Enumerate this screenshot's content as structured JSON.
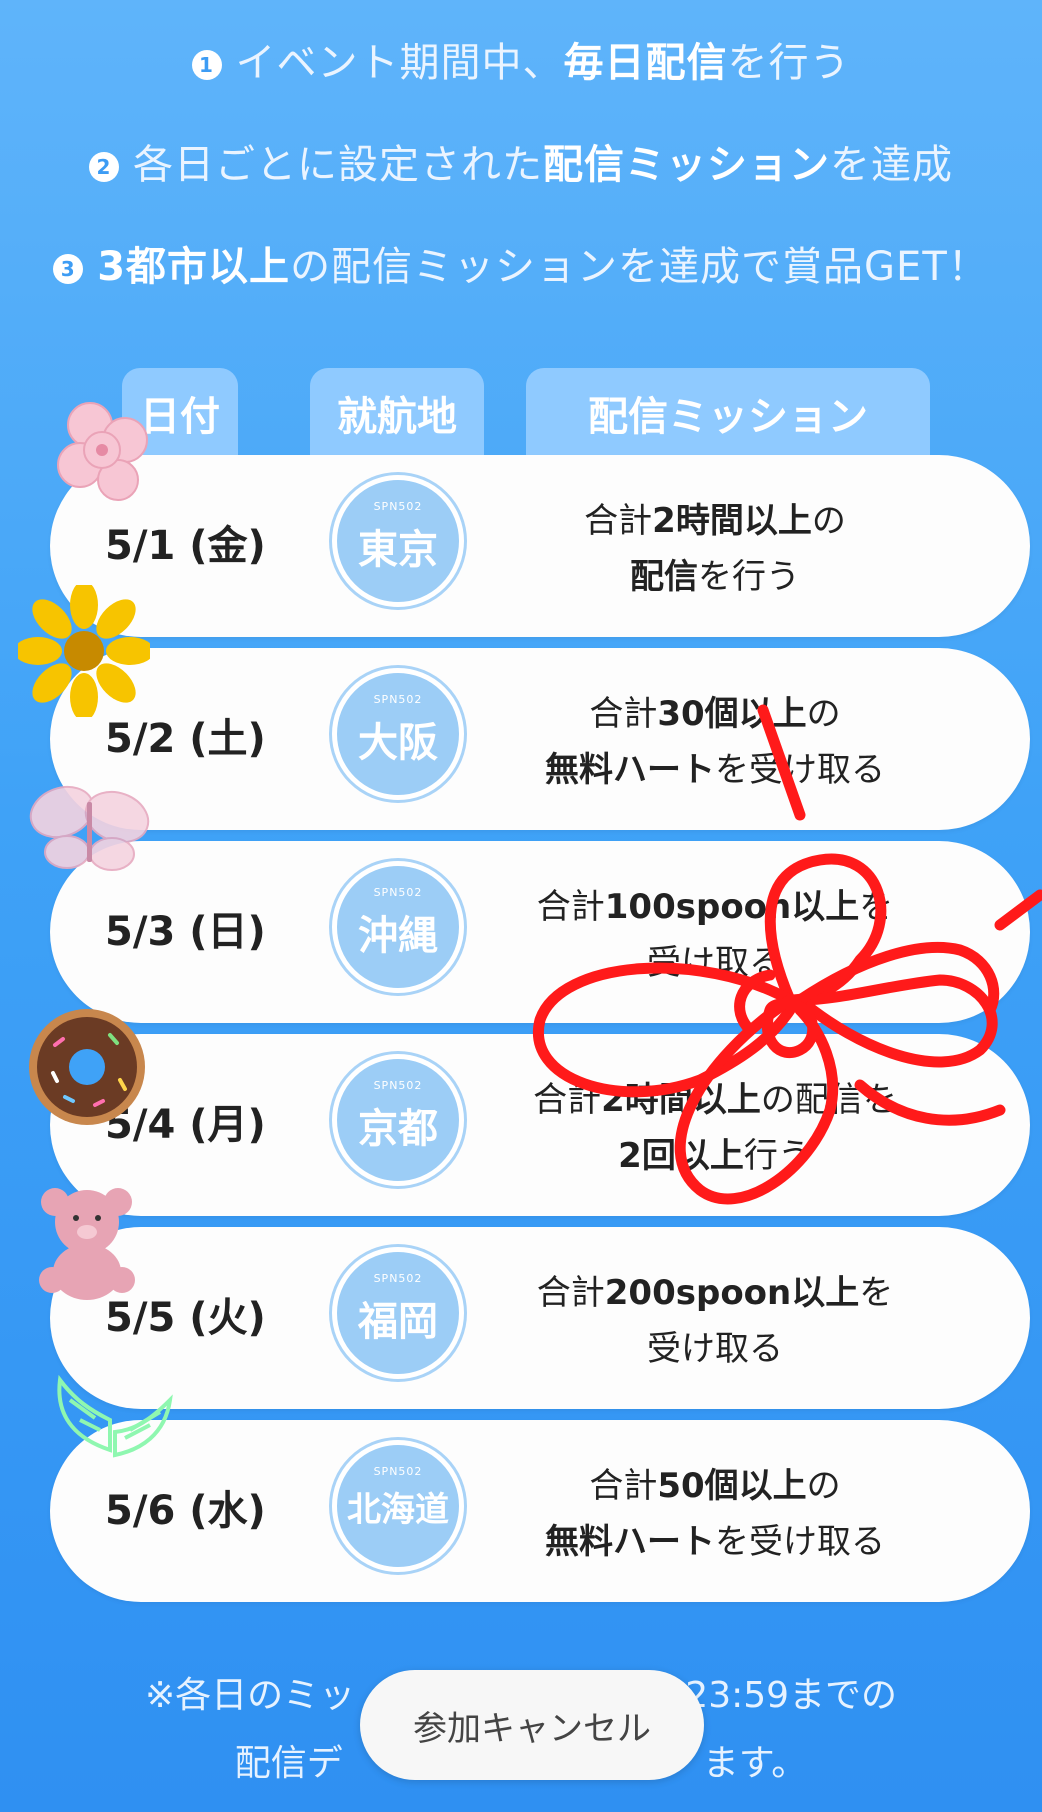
{
  "rules": [
    {
      "num": "1",
      "pre": "イベント期間中、",
      "bold": "毎日配信",
      "post": "を行う"
    },
    {
      "num": "2",
      "pre": "各日ごとに設定された",
      "bold": "配信ミッション",
      "post": "を達成"
    },
    {
      "num": "3",
      "pre": "",
      "bold": "3都市以上",
      "post": "の配信ミッションを達成で賞品GET！"
    }
  ],
  "table_headers": [
    "日付",
    "就航地",
    "配信ミッション"
  ],
  "stamp_code": "SPN502",
  "rows": [
    {
      "date": "5/1 (金)",
      "city": "東京",
      "m1_pre": "合計",
      "m1_bold": "2時間以上",
      "m1_post": "の",
      "m2_pre": "",
      "m2_bold": "配信",
      "m2_post": "を行う"
    },
    {
      "date": "5/2 (土)",
      "city": "大阪",
      "m1_pre": "合計",
      "m1_bold": "30個以上",
      "m1_post": "の",
      "m2_pre": "",
      "m2_bold": "無料ハート",
      "m2_post": "を受け取る"
    },
    {
      "date": "5/3 (日)",
      "city": "沖縄",
      "m1_pre": "合計",
      "m1_bold": "100spoon以上",
      "m1_post": "を",
      "m2_pre": "受け取る",
      "m2_bold": "",
      "m2_post": ""
    },
    {
      "date": "5/4 (月)",
      "city": "京都",
      "m1_pre": "合計",
      "m1_bold": "2時間以上",
      "m1_post": "の配信を",
      "m2_pre": "",
      "m2_bold": "2回以上",
      "m2_post": "行う"
    },
    {
      "date": "5/5 (火)",
      "city": "福岡",
      "m1_pre": "合計",
      "m1_bold": "200spoon以上",
      "m1_post": "を",
      "m2_pre": "受け取る",
      "m2_bold": "",
      "m2_post": ""
    },
    {
      "date": "5/6 (水)",
      "city": "北海道",
      "m1_pre": "合計",
      "m1_bold": "50個以上",
      "m1_post": "の",
      "m2_pre": "",
      "m2_bold": "無料ハート",
      "m2_post": "を受け取る"
    }
  ],
  "note_line1": "※各日のミッ",
  "note_line1_end": "~23:59までの",
  "note_line2": "配信デ",
  "note_line2_end": "ます。",
  "cancel_label": "参加キャンセル",
  "stickers": [
    "sakura-flower-icon",
    "sunflower-icon",
    "butterfly-icon",
    "donut-icon",
    "teddy-bear-icon",
    "angel-wings-icon"
  ],
  "colors": {
    "scribble": "#ff1a1a",
    "accent": "#3d9cf4"
  }
}
